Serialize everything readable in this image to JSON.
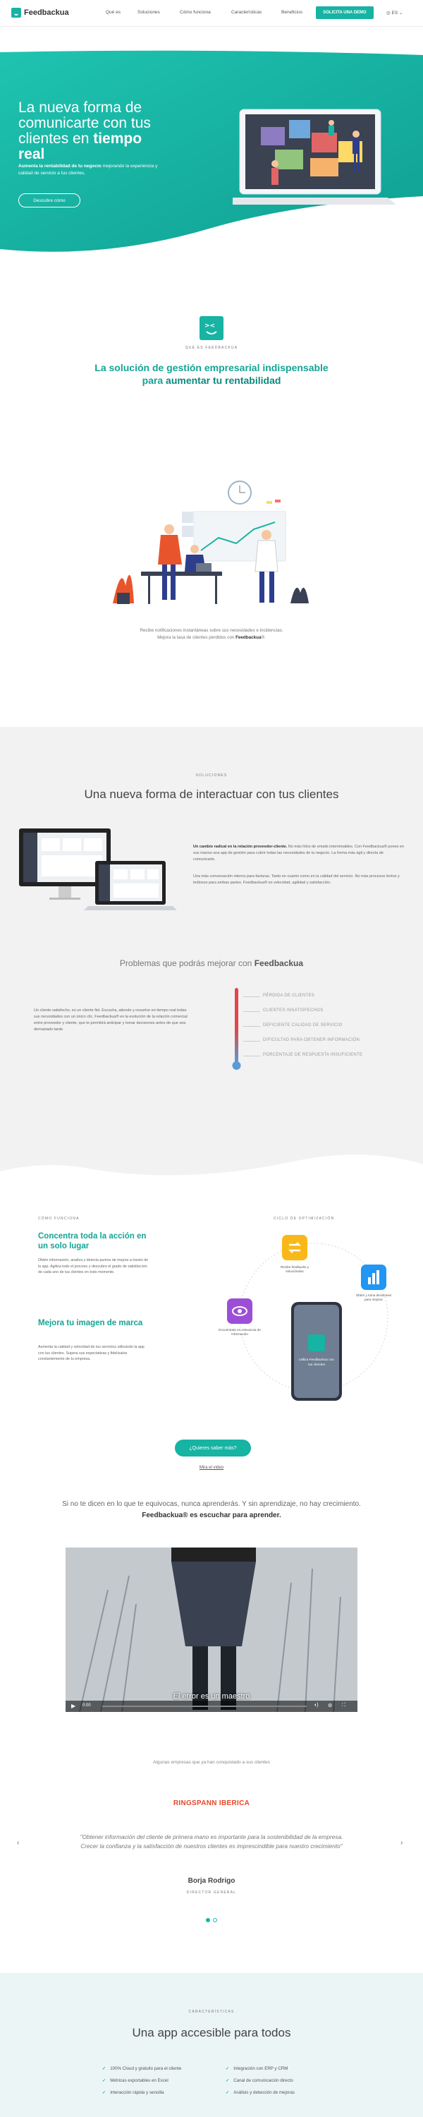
{
  "header": {
    "logo_text": "Feedbackua",
    "nav": [
      "Qué es",
      "Soluciones",
      "Cómo funciona",
      "Características",
      "Beneficios"
    ],
    "demo_button": "SOLICITA UNA DEMO",
    "language": "ES"
  },
  "hero": {
    "title_line1": "La nueva forma de",
    "title_line2": "comunicarte con tus",
    "title_line3_pre": "clientes en ",
    "title_line3_bold": "tiempo real",
    "sub_bold": "Aumenta la rentabilidad de tu negocio",
    "sub_rest": " mejorando la experiencia y calidad de servicio a tus clientes.",
    "button": "Descubre cómo"
  },
  "que_es": {
    "eyebrow": "QUÉ ES FEEDBACKUA",
    "title_line1": "La solución de gestión empresarial indispensable",
    "title_line2_pre": "para ",
    "title_line2_bold": "aumentar tu rentabilidad",
    "caption_line1": "Recibe notificaciones instantáneas sobre sus necesidades e incidencias.",
    "caption_line2_pre": "Mejora la tasa de clientes perdidos con ",
    "caption_line2_bold": "Feedbackua",
    "caption_line2_post": "®."
  },
  "soluciones": {
    "eyebrow": "SOLUCIONES",
    "title": "Una nueva forma de interactuar con tus clientes",
    "p1_bold": "Un cambio radical en la relación proveedor-cliente.",
    "p1_rest": " No más hilos de emails interminables. Con Feedbackua® pones en sus manos una app de gestión para cubrir todas las necesidades de tu negocio. La forma más ágil y directa de comunicarte.",
    "p2": "Una más conversación interna para facturas. Tanto en cuanto como en la calidad del servicio. No más procesos lentos y tediosos para ambas partes. Feedbackua® es velocidad, agilidad y satisfacción.",
    "problems_title_pre": "Problemas que podrás mejorar con ",
    "problems_title_bold": "Feedbackua",
    "problems_text": "Un cliente satisfecho, es un cliente fiel. Escucha, atiende y resuelve en tiempo real todas sus necesidades con un único clic. Feedbackua® es la evolución de la relación comercial entre proveedor y cliente, que te permitirá anticipar y tomar decisiones antes de que sea demasiado tarde.",
    "problems": [
      "PÉRDIDA DE CLIENTES",
      "CLIENTES INSATISFECHOS",
      "DEFICIENTE CALIDAD DE SERVICIO",
      "DIFICULTAD PARA OBTENER INFORMACIÓN",
      "PORCENTAJE DE RESPUESTA INSUFICIENTE"
    ]
  },
  "como_funciona": {
    "eyebrow": "CÓMO FUNCIONA",
    "h1": "Concentra toda la acción en un solo lugar",
    "p1": "Obtén información, analiza y detecta puntos de mejora a través de la app. Agiliza todo el proceso y descubre el grado de satisfacción de cada uno de tus clientes en todo momento.",
    "h2": "Mejora tu imagen de marca",
    "p2": "Aumenta la calidad y velocidad de tus servicios utilizando la app con tus clientes. Supera sus expectativas y fidelízalos constantemente de tu empresa.",
    "cycle_eyebrow": "CICLO DE OPTIMIZACIÓN",
    "cycle_1": "Recibe feedbacks y soluciónalos",
    "cycle_2": "Obtén y toma decisiones para mejorar",
    "cycle_3": "Encuéntrate en relevancia de información",
    "phone_text": "Utiliza Feedbackua con tus clientes",
    "more_button": "¿Quieres saber más?",
    "video_link": "Mira el vídeo"
  },
  "video": {
    "lead_line1": "Si no te dicen en lo que te equivocas, nunca aprenderás. Y sin aprendizaje, no hay crecimiento.",
    "lead_line2_pre": "Feedbackua",
    "lead_line2_rest": "® es escuchar para aprender.",
    "subtitle": "El error es un maestro",
    "time": "0:00"
  },
  "testimonials": {
    "intro": "Algunas empresas que ya han conquistado a sus clientes",
    "company": "RINGSPANN IBERICA",
    "quote": "\"Obtener información del cliente de primera mano es importante para la sostenibilidad de la empresa. Crecer la confianza y la satisfacción de nuestros clientes es imprescindible para nuestro crecimiento\"",
    "name": "Borja Rodrigo",
    "role": "DIRECTOR GENERAL"
  },
  "caracteristicas": {
    "eyebrow": "CARACTERÍSTICAS",
    "title": "Una app accesible para todos",
    "left": [
      "100% Cloud y gratuito para el cliente",
      "Métricas exportables en Excel",
      "Interacción rápida y sencilla"
    ],
    "right": [
      "Integración con ERP y CRM",
      "Canal de comunicación directo",
      "Análisis y detección de mejoras"
    ]
  },
  "colors": {
    "brand": "#17b3a3",
    "brand_dark": "#14a495",
    "alert": "#e0474c",
    "light_bg": "#f2f2f2"
  }
}
